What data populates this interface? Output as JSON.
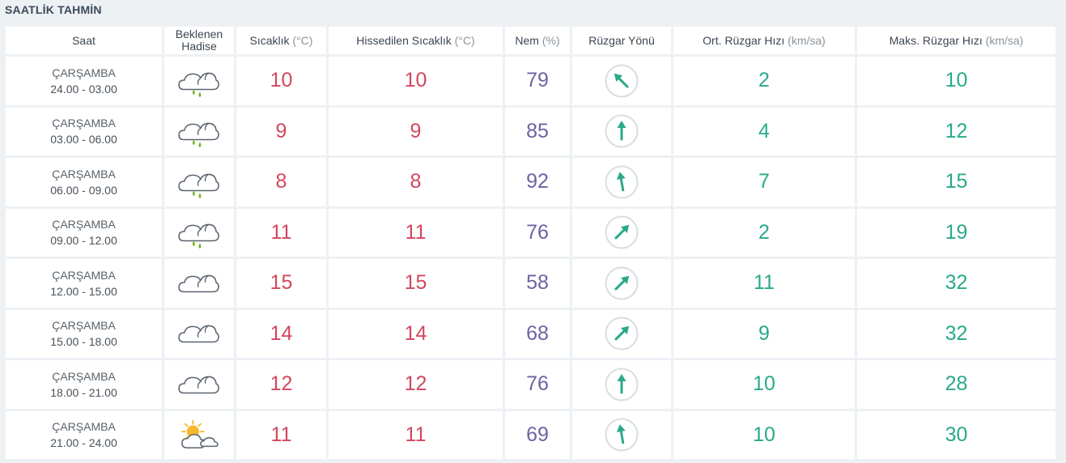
{
  "title": "SAATLİK TAHMİN",
  "columns": {
    "saat": "Saat",
    "hadise_line1": "Beklenen",
    "hadise_line2": "Hadise",
    "sicaklik": "Sıcaklık",
    "sicaklik_unit": "(°C)",
    "hissedilen": "Hissedilen Sıcaklık",
    "hissedilen_unit": "(°C)",
    "nem": "Nem",
    "nem_unit": "(%)",
    "ruzgar_yonu": "Rüzgar Yönü",
    "ort_ruzgar": "Ort. Rüzgar Hızı",
    "ort_ruzgar_unit": "(km/sa)",
    "maks_ruzgar": "Maks. Rüzgar Hızı",
    "maks_ruzgar_unit": "(km/sa)"
  },
  "colors": {
    "temperature": "#d2475e",
    "humidity": "#7062a4",
    "wind": "#2aa98a",
    "rain_drop": "#74b21f",
    "sun": "#f5b82e",
    "cloud_stroke": "#5a6470"
  },
  "rows": [
    {
      "day": "ÇARŞAMBA",
      "time": "24.00 - 03.00",
      "icon": "cloud-rain-icon",
      "temp": "10",
      "feels": "10",
      "humidity": "79",
      "wind_dir_deg": 315,
      "wind_avg": "2",
      "wind_max": "10"
    },
    {
      "day": "ÇARŞAMBA",
      "time": "03.00 - 06.00",
      "icon": "cloud-rain-icon",
      "temp": "9",
      "feels": "9",
      "humidity": "85",
      "wind_dir_deg": 0,
      "wind_avg": "4",
      "wind_max": "12"
    },
    {
      "day": "ÇARŞAMBA",
      "time": "06.00 - 09.00",
      "icon": "cloud-rain-icon",
      "temp": "8",
      "feels": "8",
      "humidity": "92",
      "wind_dir_deg": 350,
      "wind_avg": "7",
      "wind_max": "15"
    },
    {
      "day": "ÇARŞAMBA",
      "time": "09.00 - 12.00",
      "icon": "cloud-rain-icon",
      "temp": "11",
      "feels": "11",
      "humidity": "76",
      "wind_dir_deg": 45,
      "wind_avg": "2",
      "wind_max": "19"
    },
    {
      "day": "ÇARŞAMBA",
      "time": "12.00 - 15.00",
      "icon": "cloud-icon",
      "temp": "15",
      "feels": "15",
      "humidity": "58",
      "wind_dir_deg": 45,
      "wind_avg": "11",
      "wind_max": "32"
    },
    {
      "day": "ÇARŞAMBA",
      "time": "15.00 - 18.00",
      "icon": "cloud-icon",
      "temp": "14",
      "feels": "14",
      "humidity": "68",
      "wind_dir_deg": 45,
      "wind_avg": "9",
      "wind_max": "32"
    },
    {
      "day": "ÇARŞAMBA",
      "time": "18.00 - 21.00",
      "icon": "cloud-icon",
      "temp": "12",
      "feels": "12",
      "humidity": "76",
      "wind_dir_deg": 0,
      "wind_avg": "10",
      "wind_max": "28"
    },
    {
      "day": "ÇARŞAMBA",
      "time": "21.00 - 24.00",
      "icon": "sun-cloud-icon",
      "temp": "11",
      "feels": "11",
      "humidity": "69",
      "wind_dir_deg": 350,
      "wind_avg": "10",
      "wind_max": "30"
    }
  ]
}
